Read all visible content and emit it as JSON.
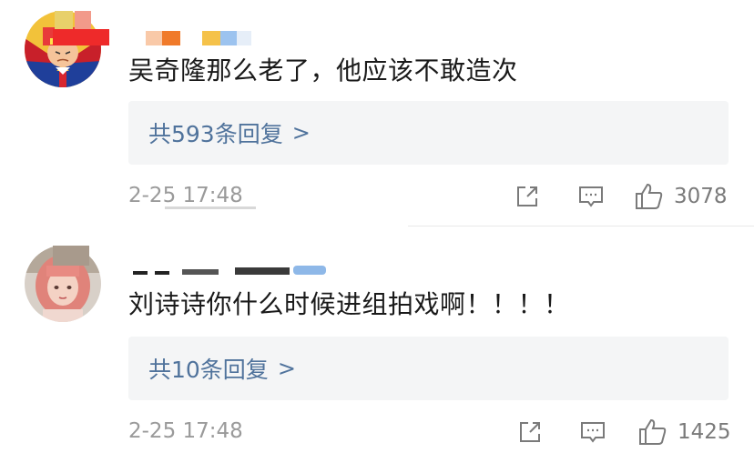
{
  "comments": [
    {
      "text": "吴奇隆那么老了，他应该不敢造次",
      "reply_label": "共593条回复",
      "reply_chevron": ">",
      "timestamp": "2-25 17:48",
      "like_count": "3078",
      "avatar_icon": "cartoon-avatar-icon"
    },
    {
      "text": "刘诗诗你什么时候进组拍戏啊！！！！",
      "reply_label": "共10条回复",
      "reply_chevron": ">",
      "timestamp": "2-25 17:48",
      "like_count": "1425",
      "avatar_icon": "photo-avatar-icon"
    }
  ],
  "colors": {
    "link_blue": "#50739c",
    "reply_bg": "#f4f5f6",
    "meta_gray": "#9a9a9a",
    "icon_gray": "#7a7a7a"
  }
}
